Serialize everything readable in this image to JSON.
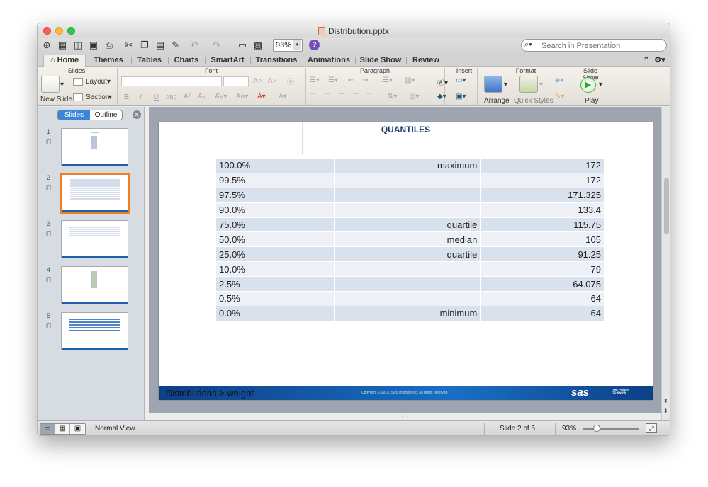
{
  "window": {
    "title": "Distribution.pptx"
  },
  "toolbar": {
    "zoom": "93%",
    "search_placeholder": "Search in Presentation"
  },
  "ribbon_tabs": [
    {
      "label": "Home"
    },
    {
      "label": "Themes"
    },
    {
      "label": "Tables"
    },
    {
      "label": "Charts"
    },
    {
      "label": "SmartArt"
    },
    {
      "label": "Transitions"
    },
    {
      "label": "Animations"
    },
    {
      "label": "Slide Show"
    },
    {
      "label": "Review"
    }
  ],
  "ribbon": {
    "groups": {
      "slides": "Slides",
      "font": "Font",
      "paragraph": "Paragraph",
      "insert": "Insert",
      "format": "Format",
      "slideshow": "Slide Show"
    },
    "new_slide": "New Slide",
    "layout": "Layout",
    "section": "Section",
    "arrange": "Arrange",
    "quick_styles": "Quick Styles",
    "play": "Play"
  },
  "panel": {
    "tab_slides": "Slides",
    "tab_outline": "Outline",
    "slides": [
      {
        "num": "1"
      },
      {
        "num": "2"
      },
      {
        "num": "3"
      },
      {
        "num": "4"
      },
      {
        "num": "5"
      }
    ]
  },
  "slide": {
    "title": "QUANTILES",
    "rows": [
      {
        "pct": "100.0%",
        "label": "maximum",
        "value": "172"
      },
      {
        "pct": "99.5%",
        "label": "",
        "value": "172"
      },
      {
        "pct": "97.5%",
        "label": "",
        "value": "171.325"
      },
      {
        "pct": "90.0%",
        "label": "",
        "value": "133.4"
      },
      {
        "pct": "75.0%",
        "label": "quartile",
        "value": "115.75"
      },
      {
        "pct": "50.0%",
        "label": "median",
        "value": "105"
      },
      {
        "pct": "25.0%",
        "label": "quartile",
        "value": "91.25"
      },
      {
        "pct": "10.0%",
        "label": "",
        "value": "79"
      },
      {
        "pct": "2.5%",
        "label": "",
        "value": "64.075"
      },
      {
        "pct": "0.5%",
        "label": "",
        "value": "64"
      },
      {
        "pct": "0.0%",
        "label": "minimum",
        "value": "64"
      }
    ],
    "footer_breadcrumb": "Distributions > weight",
    "footer_copyright": "Copyright © 2013, SAS Institute Inc. All rights reserved.",
    "footer_logo": "sas",
    "footer_tagline": "THE POWER TO KNOW."
  },
  "status": {
    "view": "Normal View",
    "slide_pos": "Slide 2 of 5",
    "zoom": "93%"
  }
}
